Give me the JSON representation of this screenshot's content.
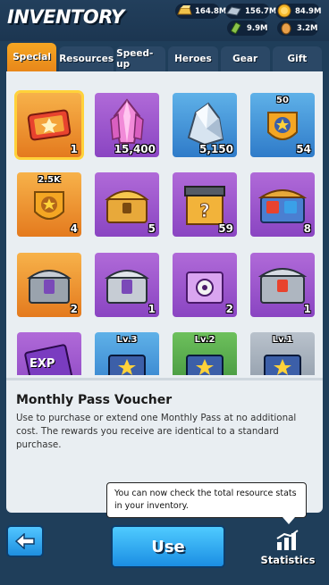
{
  "header": {
    "title": "INVENTORY",
    "resources": [
      {
        "icon": "gold-bar-icon",
        "value": "164.8M",
        "color": "#f0c24a"
      },
      {
        "icon": "iron-ingot-icon",
        "value": "156.7M",
        "color": "#b9c7d6"
      },
      {
        "icon": "coin-icon",
        "value": "84.9M",
        "color": "#f5b82a"
      },
      {
        "icon": "oil-icon",
        "value": "9.9M",
        "color": "#8bc34a"
      },
      {
        "icon": "food-icon",
        "value": "3.2M",
        "color": "#e9a04a"
      }
    ]
  },
  "tabs": [
    {
      "label": "Special",
      "active": true
    },
    {
      "label": "Resources",
      "active": false
    },
    {
      "label": "Speed-up",
      "active": false
    },
    {
      "label": "Heroes",
      "active": false
    },
    {
      "label": "Gear",
      "active": false
    },
    {
      "label": "Gift",
      "active": false
    }
  ],
  "items": [
    {
      "name": "monthly-pass-voucher",
      "qty": "1",
      "top_label": "",
      "bg": "orange",
      "icon": "voucher-icon",
      "selected": true
    },
    {
      "name": "pink-crystal",
      "qty": "15,400",
      "top_label": "",
      "bg": "purple",
      "icon": "crystal-icon",
      "selected": false
    },
    {
      "name": "silver-crystal",
      "qty": "5,150",
      "top_label": "",
      "bg": "blue",
      "icon": "silver-crystal-icon",
      "selected": false
    },
    {
      "name": "badge-50",
      "qty": "54",
      "top_label": "50",
      "bg": "blue",
      "icon": "star-badge-icon",
      "selected": false
    },
    {
      "name": "badge-2-5k",
      "qty": "4",
      "top_label": "2.5K",
      "bg": "orange",
      "icon": "star-badge-icon",
      "selected": false
    },
    {
      "name": "gold-chest",
      "qty": "5",
      "top_label": "",
      "bg": "purple",
      "icon": "gold-chest-icon",
      "selected": false
    },
    {
      "name": "mystery-box",
      "qty": "59",
      "top_label": "",
      "bg": "purple",
      "icon": "mystery-box-icon",
      "selected": false
    },
    {
      "name": "multiplier-chest",
      "qty": "8",
      "top_label": "",
      "bg": "purple",
      "icon": "multiplier-chest-icon",
      "selected": false
    },
    {
      "name": "p-chest-orange",
      "qty": "2",
      "top_label": "",
      "bg": "orange",
      "icon": "p-chest-icon",
      "selected": false
    },
    {
      "name": "p-chest-purple",
      "qty": "1",
      "top_label": "",
      "bg": "purple",
      "icon": "p-chest-icon",
      "selected": false
    },
    {
      "name": "gear-chest",
      "qty": "2",
      "top_label": "",
      "bg": "purple",
      "icon": "gear-chest-icon",
      "selected": false
    },
    {
      "name": "steel-chest",
      "qty": "1",
      "top_label": "",
      "bg": "purple",
      "icon": "steel-chest-icon",
      "selected": false
    },
    {
      "name": "exp-card",
      "qty": "",
      "top_label": "",
      "bg": "purple",
      "icon": "exp-card-icon",
      "exp_label": "EXP",
      "selected": false
    },
    {
      "name": "hero-chest-lv3",
      "qty": "",
      "top_label": "Lv.3",
      "bg": "blue",
      "icon": "hero-chest-icon",
      "selected": false
    },
    {
      "name": "hero-chest-lv2",
      "qty": "",
      "top_label": "Lv.2",
      "bg": "green",
      "icon": "hero-chest-icon",
      "selected": false
    },
    {
      "name": "hero-chest-lv1",
      "qty": "",
      "top_label": "Lv.1",
      "bg": "gray",
      "icon": "hero-chest-icon",
      "selected": false
    }
  ],
  "details": {
    "title": "Monthly Pass Voucher",
    "description": "Use to purchase or extend one Monthly Pass at no additional cost. The rewards you receive are identical to a standard purchase."
  },
  "tooltip": {
    "text": "You can now check the total resource stats in your inventory."
  },
  "footer": {
    "use_label": "Use",
    "statistics_label": "Statistics",
    "back_icon": "arrow-left-icon",
    "statistics_icon": "bar-chart-icon"
  }
}
